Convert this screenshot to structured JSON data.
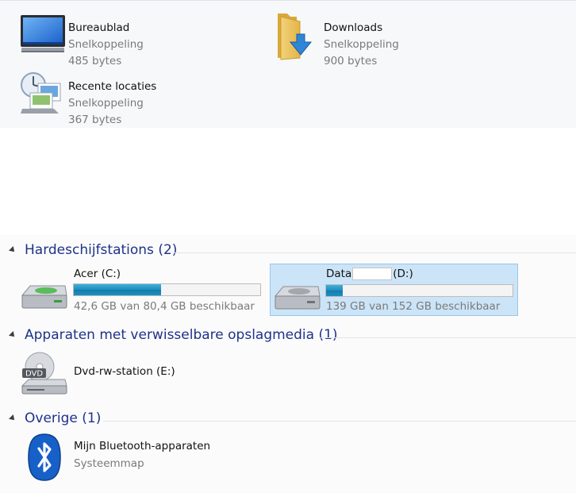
{
  "favorites": [
    {
      "name": "Bureaublad",
      "type": "Snelkoppeling",
      "size": "485 bytes",
      "icon": "desktop-icon"
    },
    {
      "name": "Downloads",
      "type": "Snelkoppeling",
      "size": "900 bytes",
      "icon": "downloads-folder-icon"
    },
    {
      "name": "Recente locaties",
      "type": "Snelkoppeling",
      "size": "367 bytes",
      "icon": "recent-places-icon"
    }
  ],
  "groups": {
    "hard_drives": {
      "title": "Hardeschijfstations (2)"
    },
    "removable": {
      "title": "Apparaten met verwisselbare opslagmedia (1)"
    },
    "other": {
      "title": "Overige (1)"
    }
  },
  "drives": [
    {
      "name": "Acer (C:)",
      "free_text": "42,6 GB van 80,4 GB beschikbaar",
      "used_fraction": 0.47,
      "icon": "hard-drive-icon",
      "selected": false
    },
    {
      "name_prefix": "Data",
      "name_suffix": "(D:)",
      "free_text": "139 GB van 152 GB beschikbaar",
      "used_fraction": 0.09,
      "icon": "hard-drive-icon",
      "selected": true
    }
  ],
  "removable": [
    {
      "name": "Dvd-rw-station (E:)",
      "icon": "dvd-drive-icon",
      "icon_label": "DVD"
    }
  ],
  "other": [
    {
      "name": "Mijn Bluetooth-apparaten",
      "type": "Systeemmap",
      "icon": "bluetooth-icon"
    }
  ],
  "colors": {
    "group_title": "#1e3287",
    "selection": "#cce4f7",
    "bar_fill": "#1e8bbf"
  }
}
